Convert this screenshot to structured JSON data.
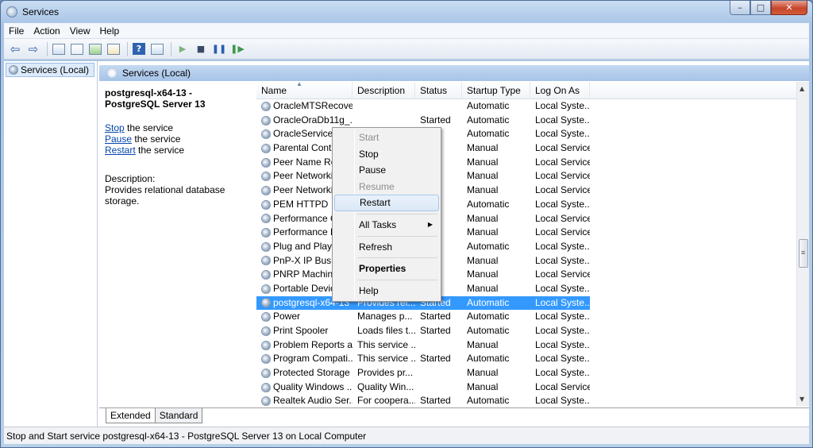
{
  "window": {
    "title": "Services",
    "min_label": "–",
    "max_label": "□",
    "close_label": "✕"
  },
  "menu": [
    "File",
    "Action",
    "View",
    "Help"
  ],
  "toolbar": {
    "icons": [
      "back-arrow",
      "forward-arrow",
      "show-hide-tree",
      "properties",
      "refresh",
      "export-list",
      "help",
      "show-hide-action-pane",
      "start-service",
      "stop-service",
      "pause-service",
      "resume-service"
    ],
    "back": "⇦",
    "forward": "⇨",
    "help": "?",
    "start": "▶",
    "stop": "■",
    "pause": "❚❚",
    "resume": "❚▶"
  },
  "tree": {
    "root": "Services (Local)"
  },
  "pane": {
    "header": "Services (Local)",
    "service_title": "postgresql-x64-13 - PostgreSQL Server 13",
    "actions": [
      {
        "link": "Stop",
        "rest": " the service"
      },
      {
        "link": "Pause",
        "rest": " the service"
      },
      {
        "link": "Restart",
        "rest": " the service"
      }
    ],
    "description_label": "Description:",
    "description_text": "Provides relational database storage."
  },
  "columns": [
    "Name",
    "Description",
    "Status",
    "Startup Type",
    "Log On As"
  ],
  "rows": [
    {
      "name": "OracleMTSRecove...",
      "desc": "",
      "status": "",
      "startup": "Automatic",
      "logon": "Local Syste..."
    },
    {
      "name": "OracleOraDb11g_...",
      "desc": "",
      "status": "Started",
      "startup": "Automatic",
      "logon": "Local Syste..."
    },
    {
      "name": "OracleServiceT",
      "desc": "",
      "status": "ed",
      "startup": "Automatic",
      "logon": "Local Syste..."
    },
    {
      "name": "Parental Contr",
      "desc": "",
      "status": "",
      "startup": "Manual",
      "logon": "Local Service"
    },
    {
      "name": "Peer Name Res",
      "desc": "",
      "status": "",
      "startup": "Manual",
      "logon": "Local Service"
    },
    {
      "name": "Peer Networkir",
      "desc": "",
      "status": "",
      "startup": "Manual",
      "logon": "Local Service"
    },
    {
      "name": "Peer Networkir",
      "desc": "",
      "status": "",
      "startup": "Manual",
      "logon": "Local Service"
    },
    {
      "name": "PEM HTTPD",
      "desc": "",
      "status": "ed",
      "startup": "Automatic",
      "logon": "Local Syste..."
    },
    {
      "name": "Performance C",
      "desc": "",
      "status": "",
      "startup": "Manual",
      "logon": "Local Service"
    },
    {
      "name": "Performance L",
      "desc": "",
      "status": "",
      "startup": "Manual",
      "logon": "Local Service"
    },
    {
      "name": "Plug and Play",
      "desc": "",
      "status": "ed",
      "startup": "Automatic",
      "logon": "Local Syste..."
    },
    {
      "name": "PnP-X IP Bus E",
      "desc": "",
      "status": "",
      "startup": "Manual",
      "logon": "Local Syste..."
    },
    {
      "name": "PNRP Machine",
      "desc": "",
      "status": "",
      "startup": "Manual",
      "logon": "Local Service"
    },
    {
      "name": "Portable Devic",
      "desc": "",
      "status": "",
      "startup": "Manual",
      "logon": "Local Syste..."
    },
    {
      "name": "postgresql-x64-13 ...",
      "desc": "Provides rel...",
      "status": "Started",
      "startup": "Automatic",
      "logon": "Local Syste...",
      "selected": true
    },
    {
      "name": "Power",
      "desc": "Manages p...",
      "status": "Started",
      "startup": "Automatic",
      "logon": "Local Syste..."
    },
    {
      "name": "Print Spooler",
      "desc": "Loads files t...",
      "status": "Started",
      "startup": "Automatic",
      "logon": "Local Syste..."
    },
    {
      "name": "Problem Reports a...",
      "desc": "This service ...",
      "status": "",
      "startup": "Manual",
      "logon": "Local Syste..."
    },
    {
      "name": "Program Compati...",
      "desc": "This service ...",
      "status": "Started",
      "startup": "Automatic",
      "logon": "Local Syste..."
    },
    {
      "name": "Protected Storage",
      "desc": "Provides pr...",
      "status": "",
      "startup": "Manual",
      "logon": "Local Syste..."
    },
    {
      "name": "Quality Windows ...",
      "desc": "Quality Win...",
      "status": "",
      "startup": "Manual",
      "logon": "Local Service"
    },
    {
      "name": "Realtek Audio Ser...",
      "desc": "For coopera...",
      "status": "Started",
      "startup": "Automatic",
      "logon": "Local Syste..."
    }
  ],
  "tabs": [
    "Extended",
    "Standard"
  ],
  "context_menu": [
    {
      "label": "Start",
      "disabled": true
    },
    {
      "label": "Stop"
    },
    {
      "label": "Pause"
    },
    {
      "label": "Resume",
      "disabled": true
    },
    {
      "label": "Restart",
      "hover": true
    },
    {
      "sep": true
    },
    {
      "label": "All Tasks",
      "submenu": true
    },
    {
      "sep": true
    },
    {
      "label": "Refresh"
    },
    {
      "sep": true
    },
    {
      "label": "Properties",
      "bold": true
    },
    {
      "sep": true
    },
    {
      "label": "Help"
    }
  ],
  "context_submenu_arrow": "▶",
  "scroll": {
    "up": "▲",
    "down": "▼",
    "grip": "≡"
  },
  "status": "Stop and Start service postgresql-x64-13 - PostgreSQL Server 13 on Local Computer"
}
